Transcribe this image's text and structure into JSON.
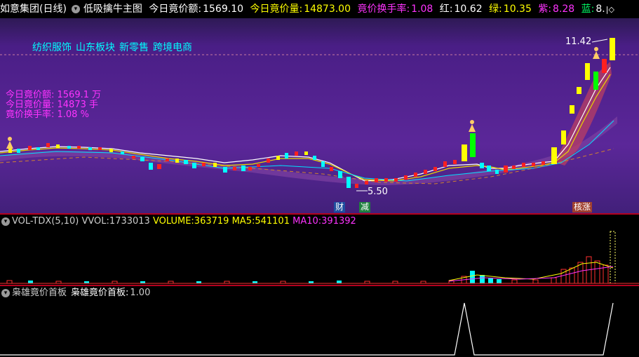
{
  "topbar": {
    "stock": "如意集团(日线)",
    "indicator": "低吸擒牛主图",
    "amount_label": "今日竟价额:",
    "amount_value": "1569.10",
    "volume_label": "今日竟价量:",
    "volume_value": "14873.00",
    "turnover_label": "竟价换手率:",
    "turnover_value": "1.08",
    "red_label": "红:",
    "red_value": "10.62",
    "green_label": "绿:",
    "green_value": "10.35",
    "purple_label": "紫:",
    "purple_value": "8.28",
    "blue_label": "蓝:",
    "blue_value": "8.",
    "nav_icon": "nav-arrows-icon"
  },
  "price_panel": {
    "sectors": [
      "纺织服饰",
      "山东板块",
      "新零售",
      "跨境电商"
    ],
    "auction_lines": [
      "今日竟价额: 1569.1 万",
      "今日竟价量: 14873 手",
      "竟价换手率: 1.08 %"
    ],
    "high_label": "11.42",
    "low_label": "5.50",
    "tags": {
      "finance": "财",
      "reduce": "减",
      "limit_up": "核涨"
    },
    "colors": {
      "up_candle": "#ffff00",
      "down_candle": "#00ffff",
      "ma_short": "#ffffff"
    }
  },
  "volume_panel": {
    "name": "VOL-TDX(5,10)",
    "vvol_label": "VVOL:",
    "vvol_value": "1733013",
    "volume_label": "VOLUME:",
    "volume_value": "363719",
    "ma5_label": "MA5:",
    "ma5_value": "541101",
    "ma10_label": "MA10:",
    "ma10_value": "391392"
  },
  "indicator_panel": {
    "name": "枭雄竟价首板",
    "label": "枭雄竟价首板:",
    "value": "1.00"
  }
}
